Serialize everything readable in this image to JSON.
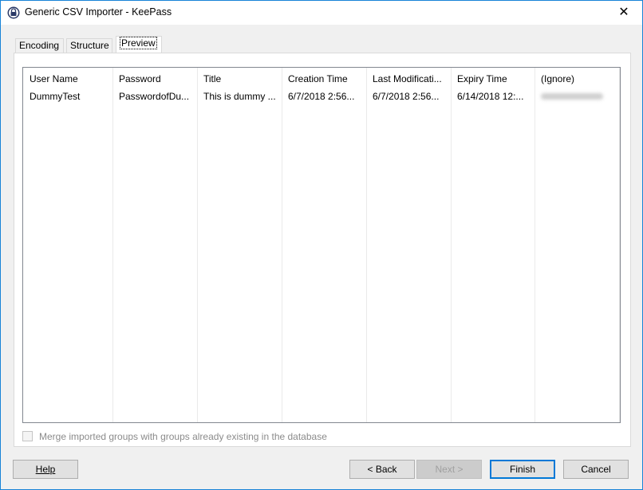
{
  "window": {
    "title": "Generic CSV Importer - KeePass",
    "close_glyph": "✕"
  },
  "tabs": [
    {
      "label": "Encoding",
      "active": false
    },
    {
      "label": "Structure",
      "active": false
    },
    {
      "label": "Preview",
      "active": true
    }
  ],
  "preview": {
    "columns": [
      "User Name",
      "Password",
      "Title",
      "Creation Time",
      "Last Modificati...",
      "Expiry Time",
      "(Ignore)"
    ],
    "rows": [
      {
        "cells": [
          "DummyTest",
          "PasswordofDu...",
          "This is dummy ...",
          "6/7/2018 2:56...",
          "6/7/2018 2:56...",
          "6/14/2018 12:...",
          ""
        ],
        "ignore_redacted": true
      }
    ]
  },
  "merge_option": {
    "label": "Merge imported groups with groups already existing in the database",
    "checked": false,
    "enabled": false
  },
  "buttons": {
    "help": "Help",
    "back": "< Back",
    "next": "Next >",
    "finish": "Finish",
    "cancel": "Cancel"
  },
  "colors": {
    "window_border": "#1883d7",
    "default_button_border": "#0078d7"
  }
}
